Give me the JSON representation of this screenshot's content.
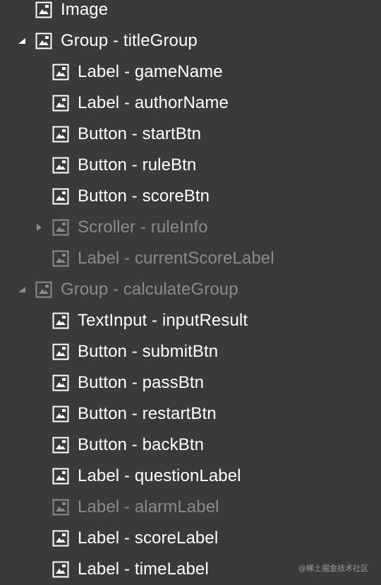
{
  "tree": {
    "items": [
      {
        "label": "Image",
        "dim": false,
        "disclosure": "none",
        "depth": 0
      },
      {
        "label": "Group - titleGroup",
        "dim": false,
        "disclosure": "expanded",
        "depth": 0
      },
      {
        "label": "Label - gameName",
        "dim": false,
        "disclosure": "none",
        "depth": 1
      },
      {
        "label": "Label - authorName",
        "dim": false,
        "disclosure": "none",
        "depth": 1
      },
      {
        "label": "Button - startBtn",
        "dim": false,
        "disclosure": "none",
        "depth": 1
      },
      {
        "label": "Button - ruleBtn",
        "dim": false,
        "disclosure": "none",
        "depth": 1
      },
      {
        "label": "Button - scoreBtn",
        "dim": false,
        "disclosure": "none",
        "depth": 1
      },
      {
        "label": "Scroller - ruleInfo",
        "dim": true,
        "disclosure": "collapsed",
        "depth": 1
      },
      {
        "label": "Label - currentScoreLabel",
        "dim": true,
        "disclosure": "none",
        "depth": 1
      },
      {
        "label": "Group - calculateGroup",
        "dim": true,
        "disclosure": "expanded",
        "depth": 0
      },
      {
        "label": "TextInput - inputResult",
        "dim": false,
        "disclosure": "none",
        "depth": 1
      },
      {
        "label": "Button - submitBtn",
        "dim": false,
        "disclosure": "none",
        "depth": 1
      },
      {
        "label": "Button - passBtn",
        "dim": false,
        "disclosure": "none",
        "depth": 1
      },
      {
        "label": "Button - restartBtn",
        "dim": false,
        "disclosure": "none",
        "depth": 1
      },
      {
        "label": "Button - backBtn",
        "dim": false,
        "disclosure": "none",
        "depth": 1
      },
      {
        "label": "Label - questionLabel",
        "dim": false,
        "disclosure": "none",
        "depth": 1
      },
      {
        "label": "Label - alarmLabel",
        "dim": true,
        "disclosure": "none",
        "depth": 1
      },
      {
        "label": "Label - scoreLabel",
        "dim": false,
        "disclosure": "none",
        "depth": 1
      },
      {
        "label": "Label - timeLabel",
        "dim": false,
        "disclosure": "none",
        "depth": 1
      }
    ]
  },
  "watermark": "@稀土掘金技术社区",
  "colors": {
    "background": "#3a3a3c",
    "text": "#ffffff",
    "text_dim": "#8a8a8c"
  },
  "icons": {
    "node": "image-node-icon",
    "expanded": "triangle-down-icon",
    "collapsed": "triangle-right-icon"
  }
}
